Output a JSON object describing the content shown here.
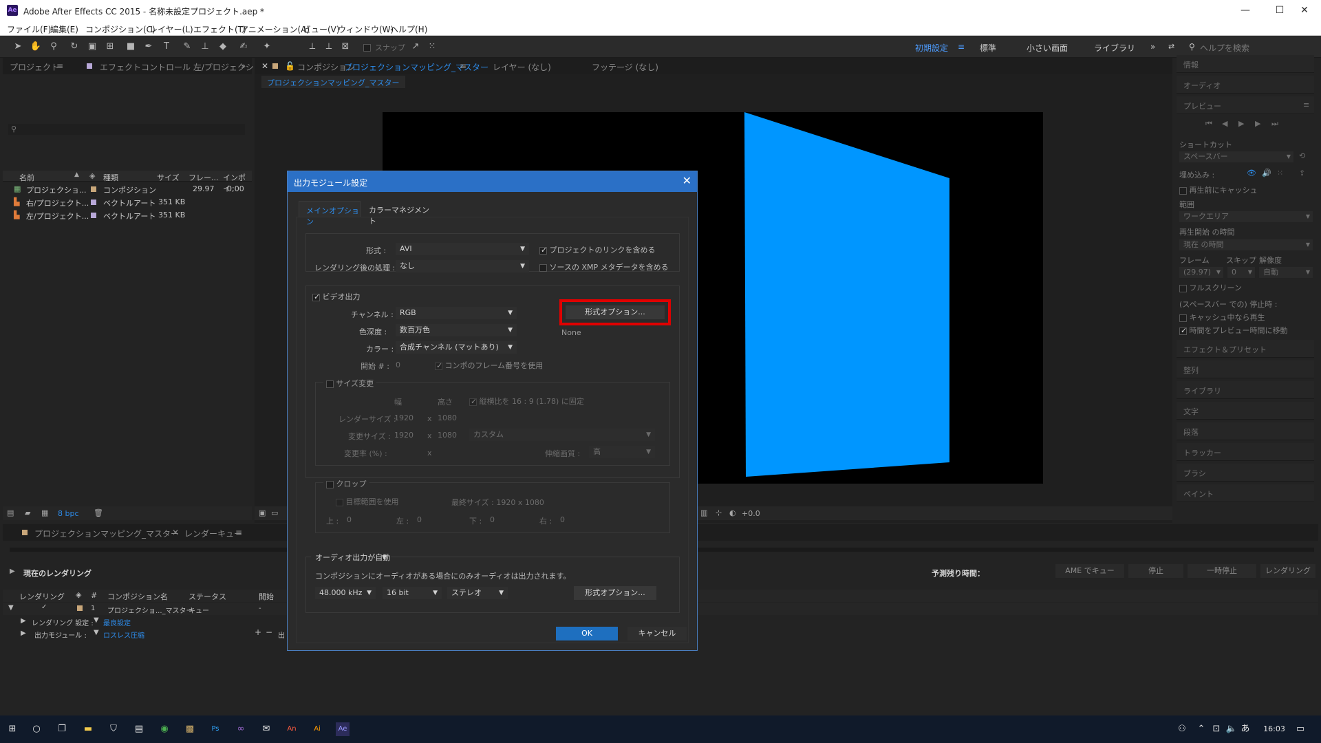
{
  "window": {
    "title": "Adobe After Effects CC 2015 - 名称未設定プロジェクト.aep *",
    "logo": "Ae"
  },
  "menu": [
    "ファイル(F)",
    "編集(E)",
    "コンポジション(C)",
    "レイヤー(L)",
    "エフェクト(T)",
    "アニメーション(A)",
    "ビュー(V)",
    "ウィンドウ(W)",
    "ヘルプ(H)"
  ],
  "toolbar": {
    "snap_label": "スナップ",
    "workspaces": [
      "初期設定",
      "標準",
      "小さい画面",
      "ライブラリ"
    ],
    "search_placeholder": "ヘルプを検索"
  },
  "project_panel": {
    "tab_project": "プロジェクト",
    "tab_effect": "エフェクトコントロール 左/プロジェクシ",
    "columns": [
      "名前",
      "種類",
      "サイズ",
      "フレー...",
      "インポイ"
    ],
    "rows": [
      {
        "name": "プロジェクショ...",
        "type": "コンポジション",
        "size": "",
        "fps": "29.97",
        "in": "0;00"
      },
      {
        "name": "右/プロジェクト...",
        "type": "ベクトルアート",
        "size": "351 KB",
        "fps": "",
        "in": ""
      },
      {
        "name": "左/プロジェクト...",
        "type": "ベクトルアート",
        "size": "351 KB",
        "fps": "",
        "in": ""
      }
    ],
    "bpc": "8 bpc"
  },
  "composition_panel": {
    "tab_comp_prefix": "コンポジション",
    "tab_comp_name": "プロジェクションマッピング_マスター",
    "tab_layer": "レイヤー (なし)",
    "tab_footage": "フッテージ (なし)",
    "sub_tab": "プロジェクションマッピング_マスター",
    "exposure": "+0.0",
    "quad_color": "#0096ff"
  },
  "right_panel": {
    "sections": [
      "情報",
      "オーディオ",
      "プレビュー"
    ],
    "shortcut_label": "ショートカット",
    "shortcut_value": "スペースバー",
    "include_label": "埋め込み :",
    "cache_before_play": "再生前にキャッシュ",
    "range_label": "範囲",
    "range_value": "ワークエリア",
    "play_start_label": "再生開始 の時間",
    "play_start_value": "現在 の時間",
    "frame_label": "フレーム",
    "skip_label": "スキップ",
    "resolution_label": "解像度",
    "frame_value": "(29.97)",
    "skip_value": "0",
    "resolution_value": "自動",
    "fullscreen": "フルスクリーン",
    "stop_label": "(スペースバー での) 停止時 :",
    "cache_play": "キャッシュ中なら再生",
    "move_time": "時間をプレビュー時間に移動",
    "more_sections": [
      "エフェクト＆プリセット",
      "整列",
      "ライブラリ",
      "文字",
      "段落",
      "トラッカー",
      "ブラシ",
      "ペイント"
    ]
  },
  "render_queue": {
    "tab_comp": "プロジェクションマッピング_マスター",
    "tab_queue": "レンダーキュー",
    "current_render": "現在のレンダリング",
    "estimated_label": "予測残り時間：",
    "buttons": [
      "AME でキュー",
      "停止",
      "一時停止",
      "レンダリング"
    ],
    "columns": [
      "レンダリング",
      "#",
      "コンポジション名",
      "ステータス",
      "開始"
    ],
    "item": {
      "num": "1",
      "comp": "プロジェクショ..._マスター",
      "status": "キュー",
      "start": "-"
    },
    "render_settings_label": "レンダリング 設定 :",
    "render_settings_value": "最良設定",
    "output_module_label": "出力モジュール :",
    "output_module_value": "ロスレス圧縮",
    "output_to_label": "出"
  },
  "dialog": {
    "title": "出力モジュール設定",
    "tabs": [
      "メインオプション",
      "カラーマネジメント"
    ],
    "format_label": "形式 :",
    "format_value": "AVI",
    "post_render_label": "レンダリング後の処理 :",
    "post_render_value": "なし",
    "include_project_link": "プロジェクトのリンクを含める",
    "include_xmp": "ソースの XMP メタデータを含める",
    "video_output": "ビデオ出力",
    "channel_label": "チャンネル :",
    "channel_value": "RGB",
    "depth_label": "色深度 :",
    "depth_value": "数百万色",
    "color_label": "カラー :",
    "color_value": "合成チャンネル (マットあり)",
    "start_label": "開始 # :",
    "start_value": "0",
    "use_comp_frame": "コンポのフレーム番号を使用",
    "format_options": "形式オプション...",
    "codec_none": "None",
    "resize": "サイズ変更",
    "width_label": "幅",
    "height_label": "高さ",
    "lock_aspect": "縦横比を 16 : 9 (1.78) に固定",
    "render_size_label": "レンダーサイズ :",
    "render_w": "1920",
    "x": "x",
    "render_h": "1080",
    "resize_to_label": "変更サイズ :",
    "resize_w": "1920",
    "resize_h": "1080",
    "resize_preset": "カスタム",
    "resize_pct_label": "変更率 (%) :",
    "resize_quality_label": "伸縮画質 :",
    "resize_quality": "高",
    "crop": "クロップ",
    "use_roi": "目標範囲を使用",
    "final_size": "最終サイズ : 1920 x 1080",
    "top": "上 :",
    "left": "左 :",
    "bottom": "下 :",
    "right": "右 :",
    "zero": "0",
    "audio_output": "オーディオ出力が自動",
    "audio_note": "コンポジションにオーディオがある場合にのみオーディオは出力されます。",
    "sample_rate": "48.000 kHz",
    "bit_depth": "16 bit",
    "channels": "ステレオ",
    "audio_format_options": "形式オプション...",
    "ok": "OK",
    "cancel": "キャンセル",
    "highlight_color": "#e00000"
  },
  "taskbar": {
    "time": "16:03",
    "ime": "あ"
  }
}
